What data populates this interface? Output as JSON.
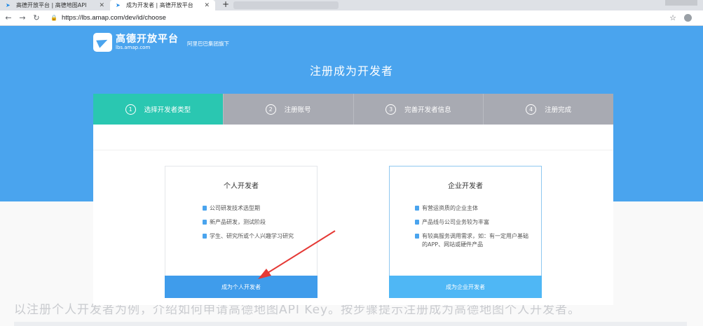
{
  "browser": {
    "tabs": [
      {
        "label": "高德开放平台 | 高德地图API",
        "active": false
      },
      {
        "label": "成为开发者 | 高德开放平台",
        "active": true
      }
    ],
    "new_tab": "+",
    "url": "https://lbs.amap.com/dev/id/choose",
    "icons": {
      "back": "back-arrow-icon",
      "forward": "forward-arrow-icon",
      "reload": "reload-icon",
      "lock": "lock-icon",
      "star": "bookmark-star-icon"
    }
  },
  "header": {
    "brand_name": "高德开放平台",
    "brand_domain": "lbs.amap.com",
    "brand_sub": "阿里巴巴集团旗下",
    "page_title": "注册成为开发者"
  },
  "steps": [
    {
      "num": "1",
      "label": "选择开发者类型",
      "active": true
    },
    {
      "num": "2",
      "label": "注册账号",
      "active": false
    },
    {
      "num": "3",
      "label": "完善开发者信息",
      "active": false
    },
    {
      "num": "4",
      "label": "注册完成",
      "active": false
    }
  ],
  "cards": {
    "personal": {
      "title": "个人开发者",
      "items": [
        "公司研发技术选型期",
        "新产品研发，测试阶段",
        "学生、研究所或个人兴趣学习研究"
      ],
      "button": "成为个人开发者"
    },
    "business": {
      "title": "企业开发者",
      "items": [
        "有营运资质的企业主体",
        "产品线与公司业务较为丰富",
        "有较高服务调用需求，如：有一定用户基础的APP、网站或硬件产品"
      ],
      "button": "成为企业开发者"
    }
  },
  "background_text": "以注册个人开发者为例，介绍如何申请高德地图API Key。按步骤提示注册成为高德地图个人开发者。",
  "colors": {
    "hero": "#4aa4ee",
    "step_active": "#2ac7b1",
    "step_inactive": "#a8aab2",
    "annotation_arrow": "#e53935"
  }
}
